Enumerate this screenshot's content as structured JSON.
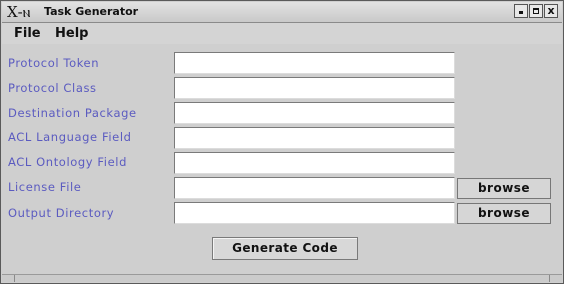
{
  "window": {
    "logo": "X‑ⲛ",
    "title": "Task Generator",
    "controls": {
      "minimize": "",
      "maximize": "",
      "close": "x"
    }
  },
  "menu": {
    "file": "File",
    "help": "Help"
  },
  "form": {
    "protocol_token": {
      "label": "Protocol Token",
      "value": ""
    },
    "protocol_class": {
      "label": "Protocol Class",
      "value": ""
    },
    "destination_package": {
      "label": "Destination Package",
      "value": ""
    },
    "acl_language": {
      "label": "ACL Language Field",
      "value": ""
    },
    "acl_ontology": {
      "label": "ACL Ontology Field",
      "value": ""
    },
    "license_file": {
      "label": "License File",
      "value": "",
      "browse": "browse"
    },
    "output_directory": {
      "label": "Output Directory",
      "value": "",
      "browse": "browse"
    }
  },
  "actions": {
    "generate": "Generate Code"
  },
  "colors": {
    "label": "#5b5bc0",
    "window_bg": "#cfcfcf"
  }
}
